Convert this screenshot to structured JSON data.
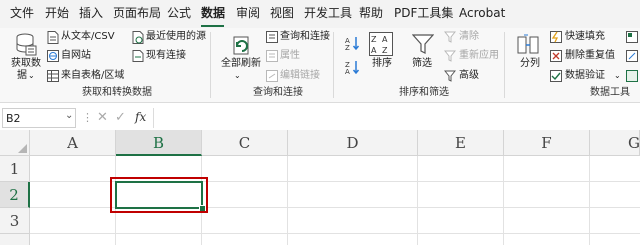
{
  "menu": {
    "tabs": [
      "文件",
      "开始",
      "插入",
      "页面布局",
      "公式",
      "数据",
      "审阅",
      "视图",
      "开发工具",
      "帮助",
      "PDF工具集",
      "Acrobat"
    ],
    "active": "数据"
  },
  "ribbon": {
    "get_data_label": "获取数",
    "get_data_label2": "据",
    "from_text_csv": "从文本/CSV",
    "from_web": "自网站",
    "from_table": "来自表格/区域",
    "recent_sources": "最近使用的源",
    "existing_connections": "现有连接",
    "group_get_transform": "获取和转换数据",
    "refresh_all": "全部刷新",
    "queries_connections": "查询和连接",
    "properties": "属性",
    "edit_links": "编辑链接",
    "group_queries": "查询和连接",
    "sort": "排序",
    "filter": "筛选",
    "clear": "清除",
    "reapply": "重新应用",
    "advanced": "高级",
    "group_sort_filter": "排序和筛选",
    "text_to_columns": "分列",
    "flash_fill": "快速填充",
    "remove_duplicates": "删除重复值",
    "data_validation": "数据验证",
    "group_data_tools": "数据工具",
    "accent_color": "#1e7145",
    "disabled_color": "#a6a6a6"
  },
  "formula_bar": {
    "name_box": "B2",
    "fx": "fx",
    "formula": ""
  },
  "sheet": {
    "columns": [
      "A",
      "B",
      "C",
      "D",
      "E",
      "F",
      "G"
    ],
    "rows": [
      "1",
      "2",
      "3"
    ],
    "selected_cell": "B2",
    "highlight_color": "#c00000"
  }
}
